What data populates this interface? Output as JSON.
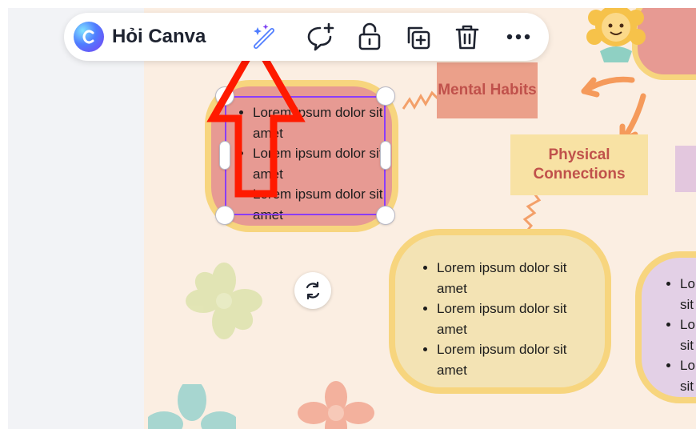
{
  "toolbar": {
    "ask_canva_label": "Hỏi Canva",
    "icons": [
      "magic-wand-icon",
      "comment-add-icon",
      "unlock-icon",
      "duplicate-icon",
      "trash-icon",
      "more-icon"
    ]
  },
  "canvas": {
    "selected_bubble": {
      "items": [
        "Lorem ipsum dolor sit amet",
        "Lorem ipsum dolor sit amet",
        "Lorem ipsum dolor sit amet"
      ]
    },
    "labels": {
      "mental": "Mental Habits",
      "physical": "Physical Connections"
    },
    "yellow_bubble": {
      "items": [
        "Lorem ipsum dolor sit amet",
        "Lorem ipsum dolor sit amet",
        "Lorem ipsum dolor sit amet"
      ]
    },
    "purple_bubble": {
      "items": [
        "Lo",
        "Lo",
        "Lo"
      ],
      "items_second": [
        "sit",
        "sit",
        "sit"
      ]
    }
  },
  "colors": {
    "accent": "#8b3dff",
    "canvas_bg": "#fbeee2",
    "pink_bubble": "#e79a93",
    "bubble_border": "#f7d57e",
    "label_text": "#c0514b",
    "annotation_arrow": "#ff1a00"
  }
}
